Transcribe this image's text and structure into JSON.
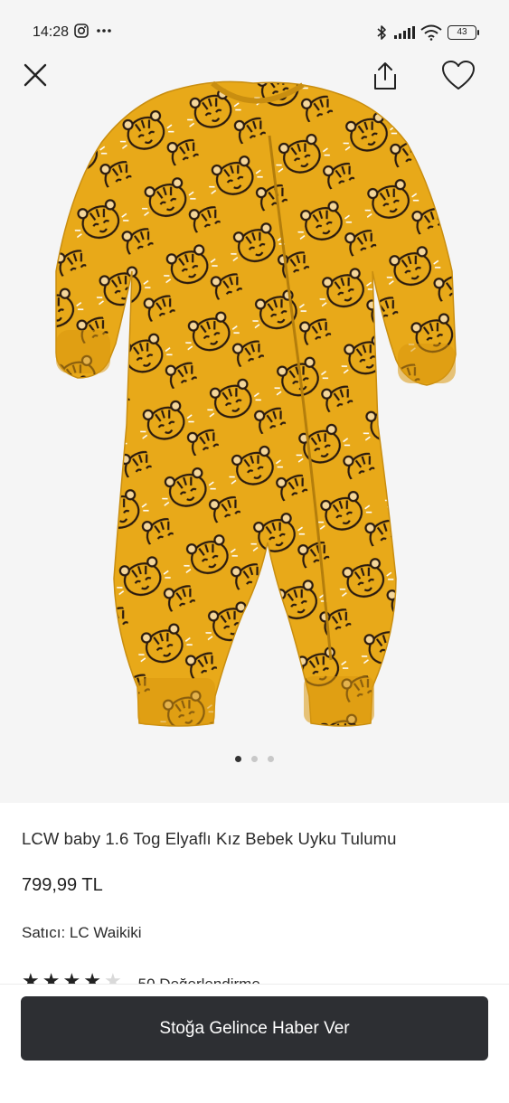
{
  "status_bar": {
    "time": "14:28",
    "battery": "43",
    "icons": [
      "instagram-icon",
      "more-icon",
      "bluetooth-icon",
      "signal-icon",
      "wifi-icon",
      "battery-icon"
    ]
  },
  "toolbar": {
    "icons": [
      "close-icon",
      "share-icon",
      "favorite-icon"
    ]
  },
  "gallery": {
    "page_count": 3,
    "active_index": 0,
    "image_colors": {
      "garment": "#E8A919",
      "background": "#F5F5F5",
      "print": "#2A1A0E"
    }
  },
  "product": {
    "title": "LCW baby 1.6 Tog Elyaflı Kız Bebek Uyku Tulumu",
    "price": "799,99 TL",
    "seller_label": "Satıcı:",
    "seller_name": "LC Waikiki",
    "rating": 4,
    "rating_max": 5,
    "review_count_text": "50 Değerlendirme"
  },
  "actions": {
    "notify_label": "Stoğa Gelince Haber Ver"
  }
}
